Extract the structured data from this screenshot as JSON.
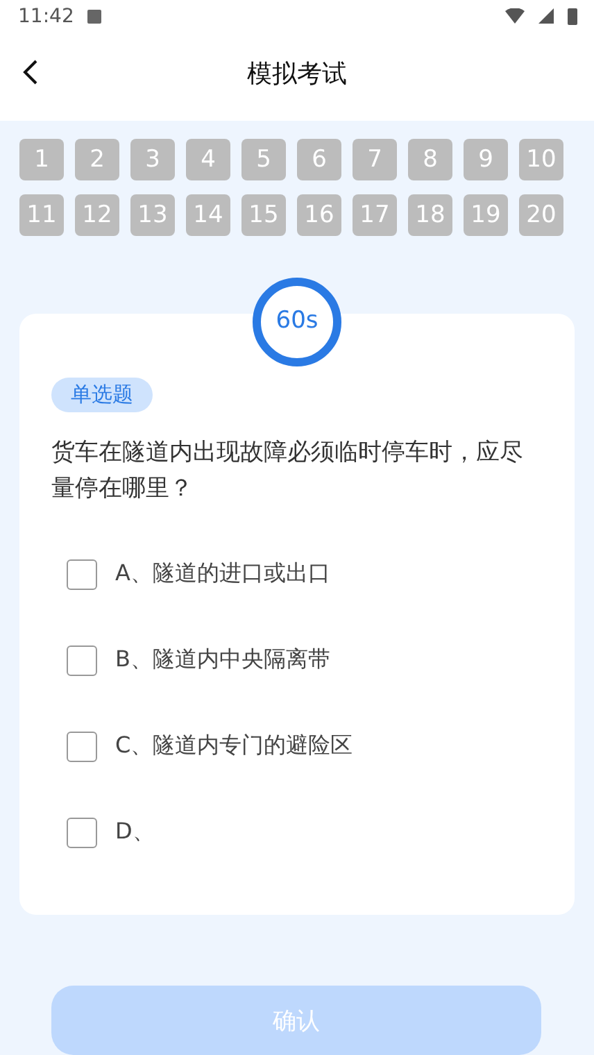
{
  "status_bar": {
    "time": "11:42"
  },
  "header": {
    "title": "模拟考试"
  },
  "question_numbers": [
    "1",
    "2",
    "3",
    "4",
    "5",
    "6",
    "7",
    "8",
    "9",
    "10",
    "11",
    "12",
    "13",
    "14",
    "15",
    "16",
    "17",
    "18",
    "19",
    "20"
  ],
  "timer": {
    "text": "60s",
    "level": 1
  },
  "question": {
    "type_tag": "单选题",
    "text": "货车在隧道内出现故障必须临时停车时，应尽量停在哪里？",
    "options": [
      {
        "label": "A、隧道的进口或出口",
        "checked": false
      },
      {
        "label": "B、隧道内中央隔离带",
        "checked": false
      },
      {
        "label": "C、隧道内专门的避险区",
        "checked": false
      },
      {
        "label": "D、",
        "checked": false
      }
    ]
  },
  "confirm_button": {
    "label": "确认",
    "disabled": true
  }
}
